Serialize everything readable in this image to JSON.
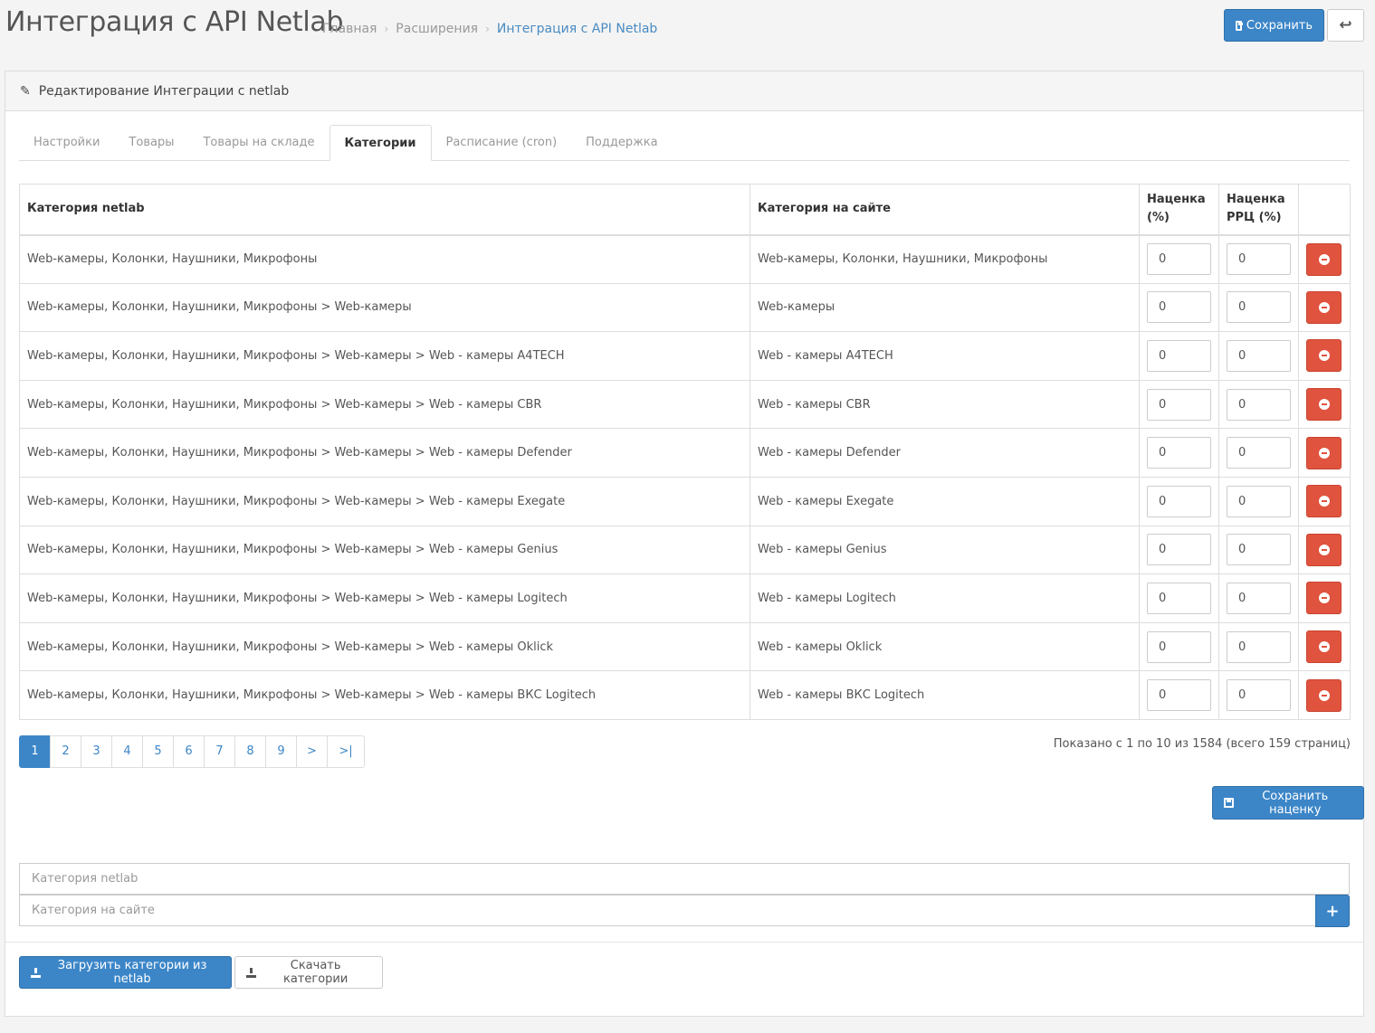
{
  "header": {
    "title": "Интеграция с API Netlab",
    "breadcrumb": [
      "Главная",
      "Расширения",
      "Интеграция с API Netlab"
    ],
    "save_label": "Сохранить",
    "back_icon": "reply-icon"
  },
  "panel": {
    "heading": "Редактирование Интеграции с netlab"
  },
  "tabs": [
    "Настройки",
    "Товары",
    "Товары на складе",
    "Категории",
    "Расписание (cron)",
    "Поддержка"
  ],
  "active_tab": "Категории",
  "table": {
    "headers": {
      "netlab": "Категория netlab",
      "site": "Категория на сайте",
      "markup": "Наценка (%)",
      "markup_rrc": "Наценка РРЦ (%)"
    },
    "rows": [
      {
        "netlab": "Web-камеры, Колонки, Наушники, Микрофоны",
        "site": "Web-камеры, Колонки, Наушники, Микрофоны",
        "markup": "0",
        "markup_rrc": "0"
      },
      {
        "netlab": "Web-камеры, Колонки, Наушники, Микрофоны > Web-камеры",
        "site": "Web-камеры",
        "markup": "0",
        "markup_rrc": "0"
      },
      {
        "netlab": "Web-камеры, Колонки, Наушники, Микрофоны > Web-камеры > Web - камеры A4TECH",
        "site": "Web - камеры A4TECH",
        "markup": "0",
        "markup_rrc": "0"
      },
      {
        "netlab": "Web-камеры, Колонки, Наушники, Микрофоны > Web-камеры > Web - камеры CBR",
        "site": "Web - камеры CBR",
        "markup": "0",
        "markup_rrc": "0"
      },
      {
        "netlab": "Web-камеры, Колонки, Наушники, Микрофоны > Web-камеры > Web - камеры Defender",
        "site": "Web - камеры Defender",
        "markup": "0",
        "markup_rrc": "0"
      },
      {
        "netlab": "Web-камеры, Колонки, Наушники, Микрофоны > Web-камеры > Web - камеры Exegate",
        "site": "Web - камеры Exegate",
        "markup": "0",
        "markup_rrc": "0"
      },
      {
        "netlab": "Web-камеры, Колонки, Наушники, Микрофоны > Web-камеры > Web - камеры Genius",
        "site": "Web - камеры Genius",
        "markup": "0",
        "markup_rrc": "0"
      },
      {
        "netlab": "Web-камеры, Колонки, Наушники, Микрофоны > Web-камеры > Web - камеры Logitech",
        "site": "Web - камеры Logitech",
        "markup": "0",
        "markup_rrc": "0"
      },
      {
        "netlab": "Web-камеры, Колонки, Наушники, Микрофоны > Web-камеры > Web - камеры Oklick",
        "site": "Web - камеры Oklick",
        "markup": "0",
        "markup_rrc": "0"
      },
      {
        "netlab": "Web-камеры, Колонки, Наушники, Микрофоны > Web-камеры > Web - камеры ВКС Logitech",
        "site": "Web - камеры ВКС Logitech",
        "markup": "0",
        "markup_rrc": "0"
      }
    ]
  },
  "pagination": {
    "pages": [
      "1",
      "2",
      "3",
      "4",
      "5",
      "6",
      "7",
      "8",
      "9",
      ">",
      ">|"
    ],
    "active": "1",
    "summary": "Показано с 1 по 10 из 1584 (всего 159 страниц)"
  },
  "save_markup_label": "Сохранить наценку",
  "add_form": {
    "netlab_placeholder": "Категория netlab",
    "site_placeholder": "Категория на сайте",
    "add_icon": "plus-icon"
  },
  "footer": {
    "load_label": "Загрузить категории из netlab",
    "download_label": "Скачать категории"
  },
  "colors": {
    "primary": "#3c86c8",
    "danger": "#e0533e",
    "link": "#4a8bc2"
  }
}
